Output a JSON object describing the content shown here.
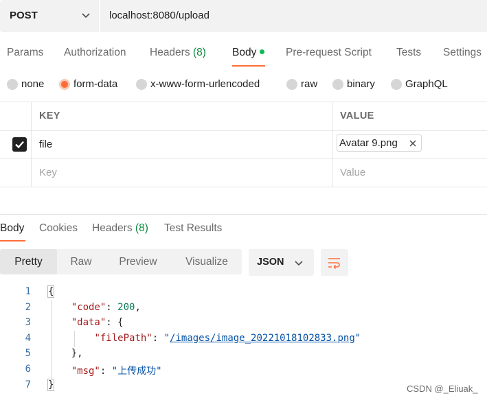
{
  "request": {
    "method": "POST",
    "url": "localhost:8080/upload"
  },
  "request_tabs": {
    "params": "Params",
    "authorization": "Authorization",
    "headers": "Headers",
    "headers_count": "(8)",
    "body": "Body",
    "prerequest": "Pre-request Script",
    "tests": "Tests",
    "settings": "Settings"
  },
  "body_types": {
    "none": "none",
    "form_data": "form-data",
    "urlencoded": "x-www-form-urlencoded",
    "raw": "raw",
    "binary": "binary",
    "graphql": "GraphQL",
    "selected": "form-data"
  },
  "params_table": {
    "key_header": "KEY",
    "value_header": "VALUE",
    "rows": [
      {
        "key": "file",
        "value": "Avatar 9.png",
        "checked": true
      }
    ],
    "key_placeholder": "Key",
    "value_placeholder": "Value"
  },
  "response_tabs": {
    "body": "Body",
    "cookies": "Cookies",
    "headers": "Headers",
    "headers_count": "(8)",
    "test_results": "Test Results"
  },
  "format": {
    "pretty": "Pretty",
    "raw": "Raw",
    "preview": "Preview",
    "visualize": "Visualize",
    "language": "JSON"
  },
  "response_json": {
    "key_code": "\"code\"",
    "value_code": "200",
    "key_data": "\"data\"",
    "key_filepath": "\"filePath\"",
    "value_filepath": "\"/images/image_20221018102833.png\"",
    "key_msg": "\"msg\"",
    "value_msg": "\"上传成功\""
  },
  "line_numbers": [
    "1",
    "2",
    "3",
    "4",
    "5",
    "6",
    "7"
  ],
  "watermark": "CSDN @_Eliuak_",
  "colors": {
    "accent": "#ff6c37",
    "active_dot": "#0cbb52",
    "count_green": "#0c8a3e",
    "json_key": "#a11b1b",
    "json_number": "#0e7c5a",
    "json_string": "#0451a5"
  },
  "icons": [
    "chevron-down-icon",
    "checkbox-checked-icon",
    "close-icon",
    "text-wrap-icon"
  ]
}
